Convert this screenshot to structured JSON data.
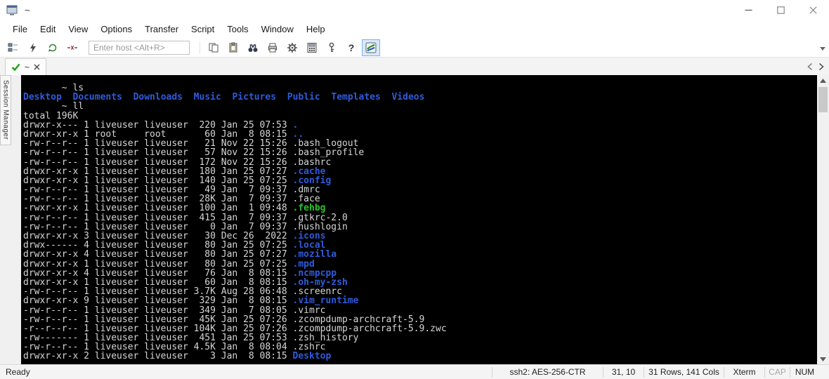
{
  "colors": {
    "term-bg": "#000000",
    "term-fg": "#d6d6d6",
    "term-blue": "#2e5bdb",
    "term-green": "#27c427"
  },
  "window": {
    "title": "~"
  },
  "menu": {
    "items": [
      "File",
      "Edit",
      "View",
      "Options",
      "Transfer",
      "Script",
      "Tools",
      "Window",
      "Help"
    ]
  },
  "toolbar": {
    "host_placeholder": "Enter host <Alt+R>",
    "help_glyph": "?"
  },
  "tabbar": {
    "tab_label": "~"
  },
  "sidebar": {
    "label": "Session Manager"
  },
  "terminal": {
    "lines": [
      [
        [
          "       ~ ls",
          "w"
        ]
      ],
      [
        [
          "Desktop",
          "b"
        ],
        [
          "  ",
          "w"
        ],
        [
          "Documents",
          "b"
        ],
        [
          "  ",
          "w"
        ],
        [
          "Downloads",
          "b"
        ],
        [
          "  ",
          "w"
        ],
        [
          "Music",
          "b"
        ],
        [
          "  ",
          "w"
        ],
        [
          "Pictures",
          "b"
        ],
        [
          "  ",
          "w"
        ],
        [
          "Public",
          "b"
        ],
        [
          "  ",
          "w"
        ],
        [
          "Templates",
          "b"
        ],
        [
          "  ",
          "w"
        ],
        [
          "Videos",
          "b"
        ]
      ],
      [
        [
          "       ~ ll",
          "w"
        ]
      ],
      [
        [
          "total 196K",
          "w"
        ]
      ],
      [
        [
          "drwxr-x--- 1 liveuser liveuser  220 Jan 25 07:53 ",
          "w"
        ],
        [
          ".",
          "b"
        ]
      ],
      [
        [
          "drwxr-xr-x 1 root     root       60 Jan  8 08:15 ",
          "w"
        ],
        [
          "..",
          "b"
        ]
      ],
      [
        [
          "-rw-r--r-- 1 liveuser liveuser   21 Nov 22 15:26 .bash_logout",
          "w"
        ]
      ],
      [
        [
          "-rw-r--r-- 1 liveuser liveuser   57 Nov 22 15:26 .bash_profile",
          "w"
        ]
      ],
      [
        [
          "-rw-r--r-- 1 liveuser liveuser  172 Nov 22 15:26 .bashrc",
          "w"
        ]
      ],
      [
        [
          "drwxr-xr-x 1 liveuser liveuser  180 Jan 25 07:27 ",
          "w"
        ],
        [
          ".cache",
          "b"
        ]
      ],
      [
        [
          "drwxr-xr-x 1 liveuser liveuser  140 Jan 25 07:25 ",
          "w"
        ],
        [
          ".config",
          "b"
        ]
      ],
      [
        [
          "-rw-r--r-- 1 liveuser liveuser   49 Jan  7 09:37 .dmrc",
          "w"
        ]
      ],
      [
        [
          "-rw-r--r-- 1 liveuser liveuser  28K Jan  7 09:37 .face",
          "w"
        ]
      ],
      [
        [
          "-rwxr-xr-x 1 liveuser liveuser  100 Jan  1 09:48 ",
          "w"
        ],
        [
          ".fehbg",
          "g"
        ]
      ],
      [
        [
          "-rw-r--r-- 1 liveuser liveuser  415 Jan  7 09:37 .gtkrc-2.0",
          "w"
        ]
      ],
      [
        [
          "-rw-r--r-- 1 liveuser liveuser    0 Jan  7 09:37 .hushlogin",
          "w"
        ]
      ],
      [
        [
          "drwxr-xr-x 3 liveuser liveuser   30 Dec 26  2022 ",
          "w"
        ],
        [
          ".icons",
          "b"
        ]
      ],
      [
        [
          "drwx------ 4 liveuser liveuser   80 Jan 25 07:25 ",
          "w"
        ],
        [
          ".local",
          "b"
        ]
      ],
      [
        [
          "drwxr-xr-x 4 liveuser liveuser   80 Jan 25 07:27 ",
          "w"
        ],
        [
          ".mozilla",
          "b"
        ]
      ],
      [
        [
          "drwxr-xr-x 1 liveuser liveuser   80 Jan 25 07:25 ",
          "w"
        ],
        [
          ".mpd",
          "b"
        ]
      ],
      [
        [
          "drwxr-xr-x 4 liveuser liveuser   76 Jan  8 08:15 ",
          "w"
        ],
        [
          ".ncmpcpp",
          "b"
        ]
      ],
      [
        [
          "drwxr-xr-x 1 liveuser liveuser   60 Jan  8 08:15 ",
          "w"
        ],
        [
          ".oh-my-zsh",
          "b"
        ]
      ],
      [
        [
          "-rw-r--r-- 1 liveuser liveuser 3.7K Aug 28 06:48 .screenrc",
          "w"
        ]
      ],
      [
        [
          "drwxr-xr-x 9 liveuser liveuser  329 Jan  8 08:15 ",
          "w"
        ],
        [
          ".vim_runtime",
          "b"
        ]
      ],
      [
        [
          "-rw-r--r-- 1 liveuser liveuser  349 Jan  7 08:05 .vimrc",
          "w"
        ]
      ],
      [
        [
          "-rw-r--r-- 1 liveuser liveuser  45K Jan 25 07:26 .zcompdump-archcraft-5.9",
          "w"
        ]
      ],
      [
        [
          "-r--r--r-- 1 liveuser liveuser 104K Jan 25 07:26 .zcompdump-archcraft-5.9.zwc",
          "w"
        ]
      ],
      [
        [
          "-rw------- 1 liveuser liveuser  451 Jan 25 07:53 .zsh_history",
          "w"
        ]
      ],
      [
        [
          "-rw-r--r-- 1 liveuser liveuser 4.5K Jan  8 08:04 .zshrc",
          "w"
        ]
      ],
      [
        [
          "drwxr-xr-x 2 liveuser liveuser    3 Jan  8 08:15 ",
          "w"
        ],
        [
          "Desktop",
          "b"
        ]
      ]
    ]
  },
  "statusbar": {
    "ready": "Ready",
    "encryption": "ssh2: AES-256-CTR",
    "cursor": "31, 10",
    "size": "31 Rows, 141 Cols",
    "emulation": "Xterm",
    "caps": "CAP",
    "num": "NUM"
  }
}
